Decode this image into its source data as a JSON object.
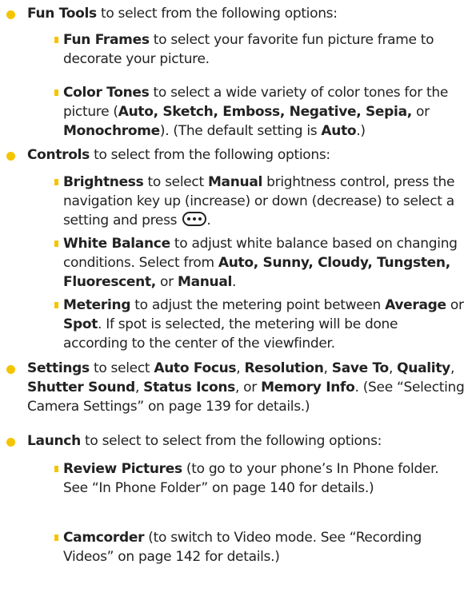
{
  "fun_tools": {
    "label": "Fun Tools",
    "text": " to select from the following options:",
    "fun_frames": {
      "label": "Fun Frames",
      "text": " to select your favorite fun picture frame to decorate your picture."
    },
    "color_tones": {
      "label": "Color Tones",
      "t1": " to select a wide variety of color tones for the picture (",
      "options": "Auto, Sketch, Emboss, Negative, Sepia,",
      "t2": " or ",
      "mono": "Monochrome",
      "t3": "). (The default setting is ",
      "default": "Auto",
      "t4": ".)"
    }
  },
  "controls": {
    "label": "Controls",
    "text": " to select from the following options:",
    "brightness": {
      "label": "Brightness",
      "t1": " to select ",
      "manual": "Manual",
      "t2": " brightness control, press the navigation key up (increase) or down (decrease) to select a setting and press ",
      "key_icon": "menu-ok-key-icon",
      "t3": "."
    },
    "white_balance": {
      "label": "White Balance",
      "t1": " to adjust white balance based on changing conditions. Select from ",
      "options": "Auto, Sunny, Cloudy, Tungsten, Fluorescent,",
      "t2": " or ",
      "manual": "Manual",
      "t3": "."
    },
    "metering": {
      "label": "Metering",
      "t1": " to adjust the metering point between ",
      "average": "Average",
      "t2": " or ",
      "spot": "Spot",
      "t3": ". If spot is selected, the metering will be done according to the center of the viewfinder."
    }
  },
  "settings": {
    "label": "Settings",
    "t1": " to select ",
    "auto_focus": "Auto Focus",
    "sep": ", ",
    "resolution": "Resolution",
    "save_to": "Save To",
    "quality": "Quality",
    "shutter_sound": "Shutter Sound",
    "status_icons": "Status Icons",
    "or": ", or ",
    "memory_info": "Memory Info",
    "t2": ". (See “Selecting Camera Settings” on page 139 for details.)"
  },
  "launch": {
    "label": "Launch",
    "text": " to select to select from the following options:",
    "review_pictures": {
      "label": "Review Pictures",
      "text": " (to go to your phone’s In Phone folder. See “In Phone Folder” on page 140 for details.)"
    },
    "camcorder": {
      "label": "Camcorder",
      "text": " (to switch to Video mode. See “Recording Videos” on page 142 for details.)"
    }
  },
  "colors": {
    "bullet": "#f5c400",
    "text": "#222222"
  }
}
